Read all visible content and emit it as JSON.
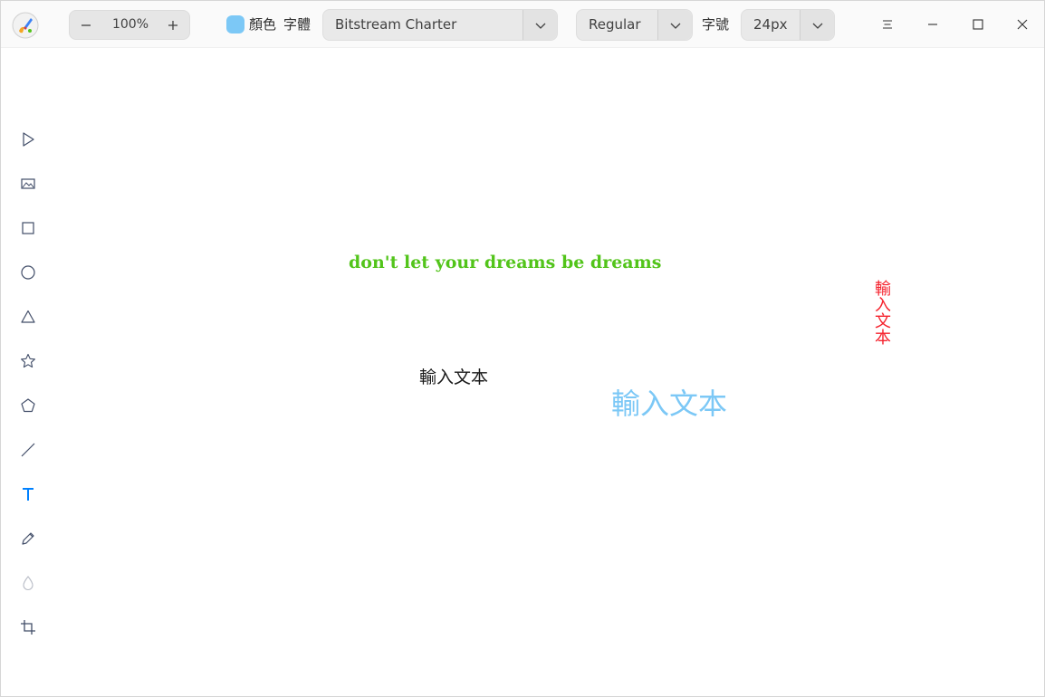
{
  "app": {
    "icon": "paintbrush-app-icon"
  },
  "zoom": {
    "value": "100%",
    "minus_icon": "minus-icon",
    "plus_icon": "plus-icon"
  },
  "color": {
    "label": "顏色",
    "current": "#7cc8f6"
  },
  "font": {
    "label": "字體",
    "family": "Bitstream Charter",
    "weight": "Regular",
    "size_label": "字號",
    "size": "24px"
  },
  "window_controls": [
    "menu-icon",
    "minimize-icon",
    "maximize-icon",
    "close-icon"
  ],
  "tools": [
    {
      "name": "select",
      "icon": "pointer-arrow-icon",
      "active": false
    },
    {
      "name": "image",
      "icon": "image-icon",
      "active": false
    },
    {
      "name": "rectangle",
      "icon": "rectangle-icon",
      "active": false
    },
    {
      "name": "ellipse",
      "icon": "ellipse-icon",
      "active": false
    },
    {
      "name": "triangle",
      "icon": "triangle-icon",
      "active": false
    },
    {
      "name": "star",
      "icon": "star-icon",
      "active": false
    },
    {
      "name": "polygon",
      "icon": "pentagon-icon",
      "active": false
    },
    {
      "name": "line",
      "icon": "line-icon",
      "active": false
    },
    {
      "name": "text",
      "icon": "text-icon",
      "active": true
    },
    {
      "name": "pencil",
      "icon": "pencil-icon",
      "active": false
    },
    {
      "name": "blur",
      "icon": "droplet-icon",
      "active": false
    },
    {
      "name": "crop",
      "icon": "crop-icon",
      "active": false
    }
  ],
  "canvas": {
    "texts": [
      {
        "content": "don't let your dreams be dreams",
        "color": "#52c41a"
      },
      {
        "content": "輸入文本",
        "color": "#1a1a1a"
      },
      {
        "content": "輸入文本",
        "color": "#7cc8f6"
      },
      {
        "content": "輸入文本",
        "color": "#f5222d"
      }
    ]
  },
  "colors": {
    "accent": "#0081ff",
    "icon": "#414d68"
  }
}
